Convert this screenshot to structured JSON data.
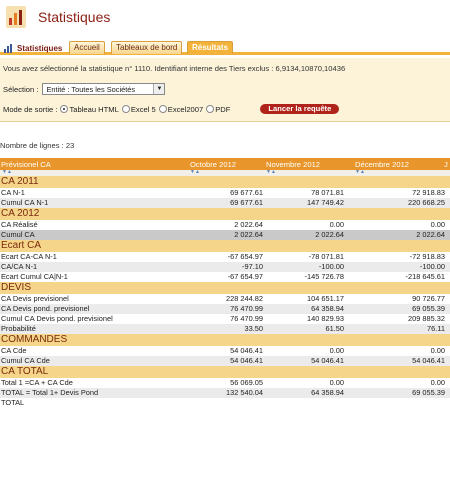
{
  "header": {
    "title": "Statistiques",
    "logo_icon": "statistics-logo-icon"
  },
  "tabs": {
    "main_label": "Statistiques",
    "items": [
      "Accueil",
      "Tableaux de bord",
      "Résultats"
    ],
    "active_index": 2
  },
  "filters": {
    "info": "Vous avez sélectionné la statistique n° 1110. Identifiant interne des Tiers exclus : 6,9134,10870,10436",
    "selection_label": "Sélection :",
    "selection_value": "Entité : Toutes les Sociétés",
    "mode_label": "Mode de sortie :",
    "modes": [
      "Tableau HTML",
      "Excel 5",
      "Excel2007",
      "PDF"
    ],
    "mode_selected": "Tableau HTML",
    "run_button": "Lancer la requête"
  },
  "row_count": "Nombre de lignes : 23",
  "table": {
    "columns": [
      "Prévisionel CA",
      "Octobre 2012",
      "Novembre 2012",
      "Décembre 2012",
      "J"
    ],
    "sections": [
      {
        "title": "CA 2011",
        "rows": [
          {
            "label": "CA N-1",
            "values": [
              "69 677.61",
              "78 071.81",
              "72 918.83"
            ]
          },
          {
            "label": "Cumul CA N-1",
            "values": [
              "69 677.61",
              "147 749.42",
              "220 668.25"
            ]
          }
        ]
      },
      {
        "title": "CA 2012",
        "rows": [
          {
            "label": "CA Réalisé",
            "values": [
              "2 022.64",
              "0.00",
              "0.00"
            ]
          },
          {
            "label": "Cumul CA",
            "values": [
              "2 022.64",
              "2 022.64",
              "2 022.64"
            ],
            "shade": "dark"
          }
        ]
      },
      {
        "title": "Ecart CA",
        "rows": [
          {
            "label": "Ecart CA-CA N-1",
            "values": [
              "-67 654.97",
              "-78 071.81",
              "-72 918.83"
            ]
          },
          {
            "label": "CA/CA N-1",
            "values": [
              "-97.10",
              "-100.00",
              "-100.00"
            ]
          },
          {
            "label": "Ecart Cumul CA|N-1",
            "values": [
              "-67 654.97",
              "-145 726.78",
              "-218 645.61"
            ]
          }
        ]
      },
      {
        "title": "DEVIS",
        "rows": [
          {
            "label": "CA Devis previsionel",
            "values": [
              "228 244.82",
              "104 651.17",
              "90 726.77"
            ]
          },
          {
            "label": "CA Devis pond. previsionel",
            "values": [
              "76 470.99",
              "64 358.94",
              "69 055.39"
            ]
          },
          {
            "label": "Cumul CA Devis pond. previsionel",
            "values": [
              "76 470.99",
              "140 829.93",
              "209 885.32"
            ]
          },
          {
            "label": "Probabilité",
            "values": [
              "33.50",
              "61.50",
              "76.11"
            ]
          }
        ]
      },
      {
        "title": "COMMANDES",
        "rows": [
          {
            "label": "CA Cde",
            "values": [
              "54 046.41",
              "0.00",
              "0.00"
            ]
          },
          {
            "label": "Cumul CA Cde",
            "values": [
              "54 046.41",
              "54 046.41",
              "54 046.41"
            ]
          }
        ]
      },
      {
        "title": "CA TOTAL",
        "rows": [
          {
            "label": "Total 1 =CA + CA Cde",
            "values": [
              "56 069.05",
              "0.00",
              "0.00"
            ]
          },
          {
            "label": "TOTAL = Total 1+ Devis Pond",
            "values": [
              "132 540.04",
              "64 358.94",
              "69 055.39"
            ]
          },
          {
            "label": "TOTAL",
            "values": [
              "",
              "",
              ""
            ]
          }
        ]
      }
    ]
  }
}
